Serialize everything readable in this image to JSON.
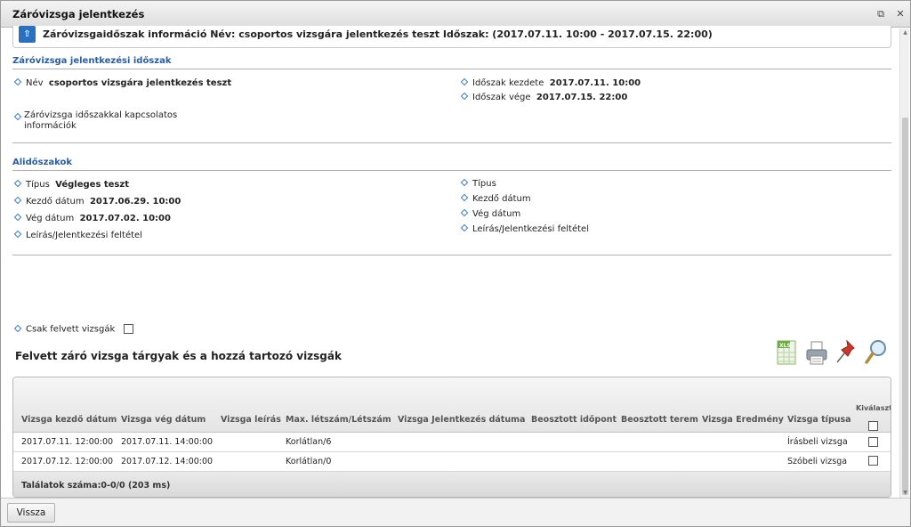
{
  "window": {
    "title": "Záróvizsga jelentkezés"
  },
  "info_panel": {
    "text": "Záróvizsgaidőszak információ Név: csoportos vizsgára jelentkezés teszt Időszak: (2017.07.11. 10:00 - 2017.07.15. 22:00)"
  },
  "period_section": {
    "title": "Záróvizsga jelentkezési időszak",
    "name_label": "Név",
    "name_value": "csoportos vizsgára jelentkezés teszt",
    "start_label": "Időszak kezdete",
    "start_value": "2017.07.11. 10:00",
    "end_label": "Időszak vége",
    "end_value": "2017.07.15. 22:00",
    "info_label": "Záróvizsga időszakkal kapcsolatos információk"
  },
  "subperiods": {
    "title": "Alidőszakok",
    "left": {
      "type_label": "Típus",
      "type_value": "Végleges teszt",
      "start_label": "Kezdő dátum",
      "start_value": "2017.06.29. 10:00",
      "end_label": "Vég dátum",
      "end_value": "2017.07.02. 10:00",
      "desc_label": "Leírás/Jelentkezési feltétel"
    },
    "right": {
      "type_label": "Típus",
      "start_label": "Kezdő dátum",
      "end_label": "Vég dátum",
      "desc_label": "Leírás/Jelentkezési feltétel"
    }
  },
  "filter": {
    "only_enrolled_label": "Csak felvett vizsgák",
    "only_enrolled_checked": false
  },
  "list": {
    "title": "Felvett záró vizsga tárgyak és a hozzá tartozó vizsgák",
    "columns": [
      "Vizsga kezdő dátum",
      "Vizsga vég dátum",
      "Vizsga leírás",
      "Max. létszám/Létszám",
      "Vizsga Jelentkezés dátuma",
      "Beosztott időpont",
      "Beosztott terem",
      "Vizsga Eredmény",
      "Vizsga típusa",
      "Kiválaszt"
    ],
    "rows": [
      {
        "start": "2017.07.11. 12:00:00",
        "end": "2017.07.11. 14:00:00",
        "desc": "",
        "capacity": "Korlátlan/6",
        "signup": "",
        "slot": "",
        "room": "",
        "result": "",
        "type": "Írásbeli vizsga"
      },
      {
        "start": "2017.07.12. 12:00:00",
        "end": "2017.07.12. 14:00:00",
        "desc": "",
        "capacity": "Korlátlan/0",
        "signup": "",
        "slot": "",
        "room": "",
        "result": "",
        "type": "Szóbeli vizsga"
      }
    ],
    "footer": "Találatok száma:0-0/0 (203 ms)"
  },
  "toolbar_icons": [
    "excel-export-icon",
    "print-icon",
    "pin-icon",
    "search-icon"
  ],
  "buttons": {
    "back": "Vissza"
  },
  "colors": {
    "accent": "#2a5ea0",
    "collapse_button": "#2a6fc0"
  }
}
